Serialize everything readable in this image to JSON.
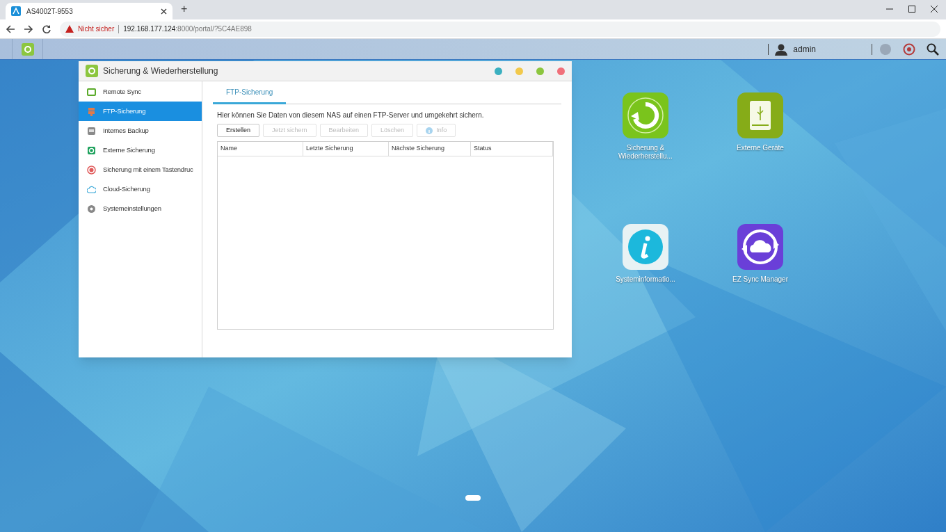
{
  "browser": {
    "tab": {
      "title": "AS4002T-9553",
      "selected": true
    },
    "new_tab": "+",
    "address": {
      "security": "Nicht sicher",
      "host": "192.168.177.124",
      "path": ":8000/portal/?5C4AE898"
    }
  },
  "top_bar": {
    "user": "admin"
  },
  "window": {
    "title": "Sicherung & Wiederherstellung",
    "sidebar": {
      "items": [
        {
          "label": "Remote Sync",
          "kind": "sync",
          "selected": false
        },
        {
          "label": "FTP-Sicherung",
          "kind": "ftp",
          "selected": true
        },
        {
          "label": "Internes Backup",
          "kind": "internal",
          "selected": false
        },
        {
          "label": "Externe Sicherung",
          "kind": "external",
          "selected": false
        },
        {
          "label": "Sicherung mit einem Tastendruc",
          "kind": "button",
          "selected": false
        },
        {
          "label": "Cloud-Sicherung",
          "kind": "cloud",
          "selected": false
        },
        {
          "label": "Systemeinstellungen",
          "kind": "gear",
          "selected": false
        }
      ]
    },
    "tabs": [
      {
        "label": "FTP-Sicherung",
        "selected": true
      }
    ],
    "description": "Hier können Sie Daten von diesem NAS auf einen FTP-Server und umgekehrt sichern.",
    "buttons": [
      {
        "label": "Erstellen",
        "disabled": false
      },
      {
        "label": "Jetzt sichern",
        "disabled": true
      },
      {
        "label": "Bearbeiten",
        "disabled": true
      },
      {
        "label": "Löschen",
        "disabled": true
      },
      {
        "label": "Info",
        "kind": "info",
        "disabled": true
      }
    ],
    "table": {
      "columns": [
        "Name",
        "Letzte Sicherung",
        "Nächste Sicherung",
        "Status"
      ]
    }
  },
  "desktop_icons": [
    {
      "label": "Sicherung &\nWiederherstellu...",
      "kind": "backup"
    },
    {
      "label": "Externe Geräte",
      "kind": "external"
    },
    {
      "label": "Systeminformatio...",
      "kind": "info"
    },
    {
      "label": "EZ Sync Manager",
      "kind": "ezsync"
    }
  ]
}
